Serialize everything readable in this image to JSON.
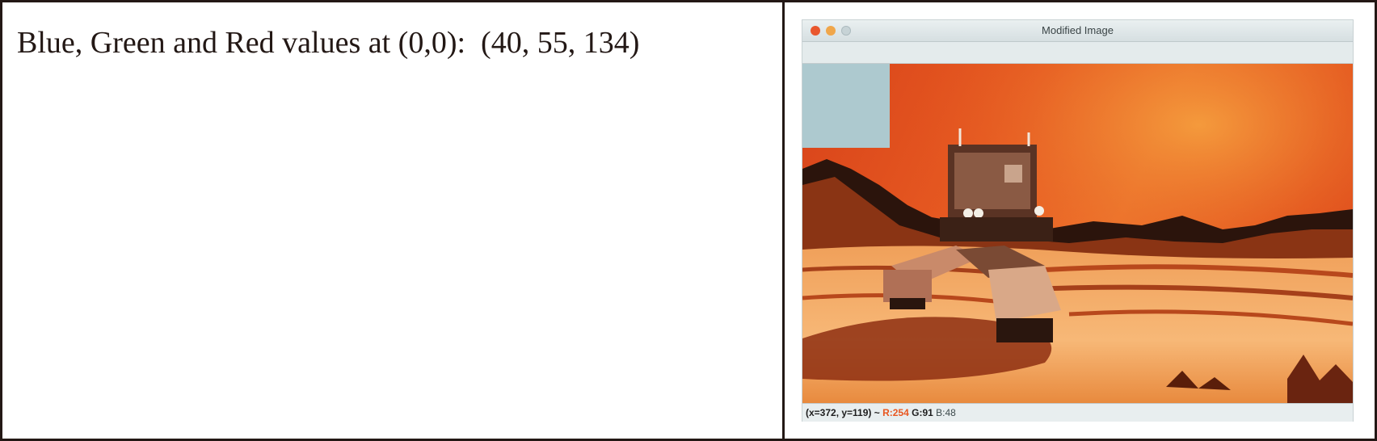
{
  "console": {
    "line": "Blue, Green and Red values at (0,0):  (40, 55, 134)"
  },
  "image_window": {
    "title": "Modified Image",
    "status": {
      "coords": "(x=372, y=119) ~ ",
      "r": "R:254",
      "g": " G:91",
      "b": " B:48"
    }
  },
  "colors": {
    "roi_patch": "#adc9cf",
    "sky_orange": "#e85c22",
    "status_red": "#e8561f"
  }
}
